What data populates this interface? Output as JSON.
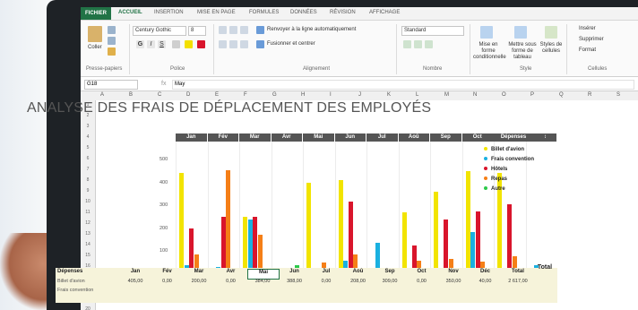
{
  "ribbon": {
    "file_tab": "FICHIER",
    "tabs": [
      "ACCUEIL",
      "INSERTION",
      "MISE EN PAGE",
      "FORMULES",
      "DONNÉES",
      "RÉVISION",
      "AFFICHAGE"
    ],
    "paste_label": "Coller",
    "clipboard_label": "Presse-papiers",
    "font_label": "Police",
    "font_name": "Century Gothic",
    "font_size": "8",
    "alignment_label": "Alignement",
    "wrap_text": "Renvoyer à la ligne automatiquement",
    "merge_center": "Fusionner et centrer",
    "number_label": "Nombre",
    "number_format": "Standard",
    "conditional_format": "Mise en forme conditionnelle",
    "format_table": "Mettre sous forme de tableau",
    "cell_styles": "Styles de cellules",
    "style_label": "Style",
    "insert": "Insérer",
    "delete": "Supprimer",
    "format": "Format",
    "cells_label": "Cellules"
  },
  "formula_bar": {
    "name_box": "G18",
    "content": "May"
  },
  "columns": [
    "A",
    "B",
    "C",
    "D",
    "E",
    "F",
    "G",
    "H",
    "I",
    "J",
    "K",
    "L",
    "M",
    "N",
    "O",
    "P",
    "Q",
    "R",
    "S"
  ],
  "rows": [
    "1",
    "2",
    "3",
    "4",
    "5",
    "6",
    "7",
    "8",
    "9",
    "10",
    "11",
    "12",
    "13",
    "14",
    "15",
    "16",
    "17",
    "18",
    "19",
    "20"
  ],
  "title": "ANALYSE DES FRAIS DE DÉPLACEMENT DES EMPLOYÉS",
  "chart_data": {
    "type": "bar",
    "categories": [
      "Jan",
      "Fév",
      "Mar",
      "Avr",
      "Mai",
      "Jun",
      "Jul",
      "Aoû",
      "Sep",
      "Oct",
      "Nov",
      "Déc"
    ],
    "ylim": [
      0,
      500
    ],
    "yticks": [
      500,
      400,
      300,
      200,
      100
    ],
    "legend_title": "Dépenses",
    "legend_position": "right",
    "series": [
      {
        "name": "Billet d'avion",
        "color": "#f2e400",
        "values": [
          440,
          0,
          250,
          0,
          400,
          410,
          0,
          270,
          360,
          450,
          440,
          0
        ]
      },
      {
        "name": "Frais convention",
        "color": "#1ab0e0",
        "values": [
          40,
          30,
          240,
          0,
          0,
          60,
          135,
          0,
          0,
          185,
          0,
          40
        ]
      },
      {
        "name": "Hôtels",
        "color": "#d9152c",
        "values": [
          200,
          250,
          250,
          0,
          0,
          315,
          0,
          125,
          240,
          275,
          305,
          0
        ]
      },
      {
        "name": "Repas",
        "color": "#f57f17",
        "values": [
          85,
          455,
          170,
          0,
          50,
          85,
          0,
          60,
          65,
          55,
          80,
          0
        ]
      },
      {
        "name": "Autre",
        "color": "#2cc94a",
        "values": [
          0,
          0,
          0,
          40,
          25,
          0,
          0,
          0,
          0,
          0,
          0,
          15
        ]
      }
    ]
  },
  "table": {
    "header_label": "Dépenses",
    "months": [
      "Jan",
      "Fév",
      "Mar",
      "Avr",
      "Mai",
      "Jun",
      "Jul",
      "Aoû",
      "Sep",
      "Oct",
      "Nov",
      "Déc"
    ],
    "total_label": "Total",
    "trend_label": "Total",
    "rows": [
      {
        "label": "Billet d'avion",
        "values": [
          "405,00",
          "0,00",
          "200,00",
          "0,00",
          "384,00",
          "388,00",
          "0,00",
          "208,00",
          "309,00",
          "0,00",
          "350,00",
          "40,00"
        ],
        "total": "2 617,00"
      },
      {
        "label": "Frais convention",
        "values": [
          "",
          "",
          "",
          "",
          "",
          "",
          "",
          "",
          "",
          "",
          "",
          ""
        ],
        "total": ""
      }
    ],
    "selected_cell": "Mai"
  },
  "colors": {
    "excel_green": "#217346",
    "header_dark": "#555555",
    "table_bg": "#f6f3da"
  }
}
